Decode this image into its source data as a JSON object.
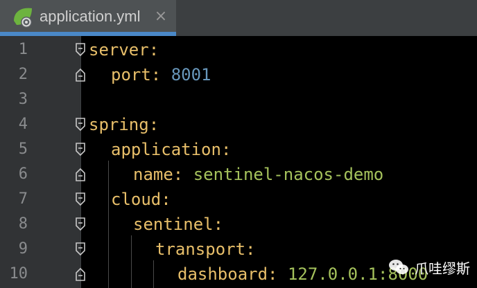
{
  "tab": {
    "title": "application.yml",
    "close_glyph": "×",
    "file_icon": "spring-leaf-gear-icon"
  },
  "colors": {
    "key": "#e8bf6a",
    "number": "#6897bb",
    "string": "#a5c25c",
    "tab_accent": "#4a88c7"
  },
  "editor": {
    "lines": [
      {
        "no": "1",
        "key": "server",
        "colon": ":",
        "value": ""
      },
      {
        "no": "2",
        "key": "port",
        "colon": ":",
        "value": "8001"
      },
      {
        "no": "3",
        "key": "",
        "colon": "",
        "value": ""
      },
      {
        "no": "4",
        "key": "spring",
        "colon": ":",
        "value": ""
      },
      {
        "no": "5",
        "key": "application",
        "colon": ":",
        "value": ""
      },
      {
        "no": "6",
        "key": "name",
        "colon": ":",
        "value": "sentinel-nacos-demo"
      },
      {
        "no": "7",
        "key": "cloud",
        "colon": ":",
        "value": ""
      },
      {
        "no": "8",
        "key": "sentinel",
        "colon": ":",
        "value": ""
      },
      {
        "no": "9",
        "key": "transport",
        "colon": ":",
        "value": ""
      },
      {
        "no": "10",
        "key": "dashboard",
        "colon": ":",
        "value": "127.0.0.1:8000"
      }
    ]
  },
  "watermark": {
    "text": "爪哇缪斯",
    "icon": "wechat-icon"
  }
}
